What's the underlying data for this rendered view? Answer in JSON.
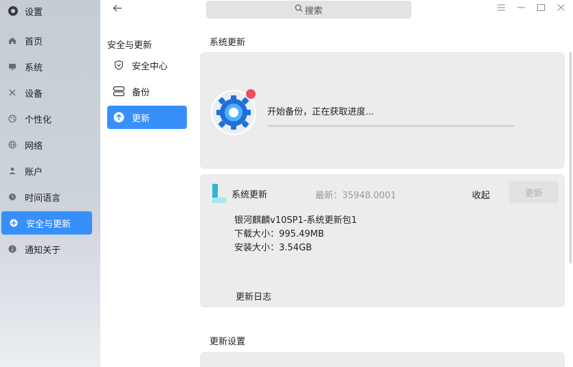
{
  "app": {
    "title": "设置"
  },
  "sidebar": {
    "items": [
      {
        "label": "首页",
        "icon": "home-icon"
      },
      {
        "label": "系统",
        "icon": "monitor-icon"
      },
      {
        "label": "设备",
        "icon": "tools-icon"
      },
      {
        "label": "个性化",
        "icon": "palette-icon"
      },
      {
        "label": "网络",
        "icon": "globe-icon"
      },
      {
        "label": "账户",
        "icon": "user-icon"
      },
      {
        "label": "时间语言",
        "icon": "clock-icon"
      },
      {
        "label": "安全与更新",
        "icon": "shield-update-icon",
        "active": true
      },
      {
        "label": "通知关于",
        "icon": "info-icon"
      }
    ]
  },
  "subnav": {
    "title": "安全与更新",
    "items": [
      {
        "label": "安全中心",
        "icon": "shield-icon"
      },
      {
        "label": "备份",
        "icon": "backup-icon"
      },
      {
        "label": "更新",
        "icon": "arrow-up-circle-icon",
        "active": true
      }
    ]
  },
  "search": {
    "placeholder": "搜索"
  },
  "main": {
    "system_update_title": "系统更新",
    "backup_status": "开始备份，正在获取进度...",
    "backup_progress": 0.0,
    "update": {
      "name": "系统更新",
      "latest": "最新：35948.0001",
      "collapse": "收起",
      "button": "更新",
      "package": "银河麒麟v10SP1-系统更新包1",
      "download_size": "下载大小：995.49MB",
      "install_size": "安装大小：3.54GB",
      "log": "更新日志"
    },
    "settings_title": "更新设置"
  },
  "colors": {
    "accent": "#3790fa",
    "card": "#ececec",
    "badge": "#f04e5e"
  }
}
